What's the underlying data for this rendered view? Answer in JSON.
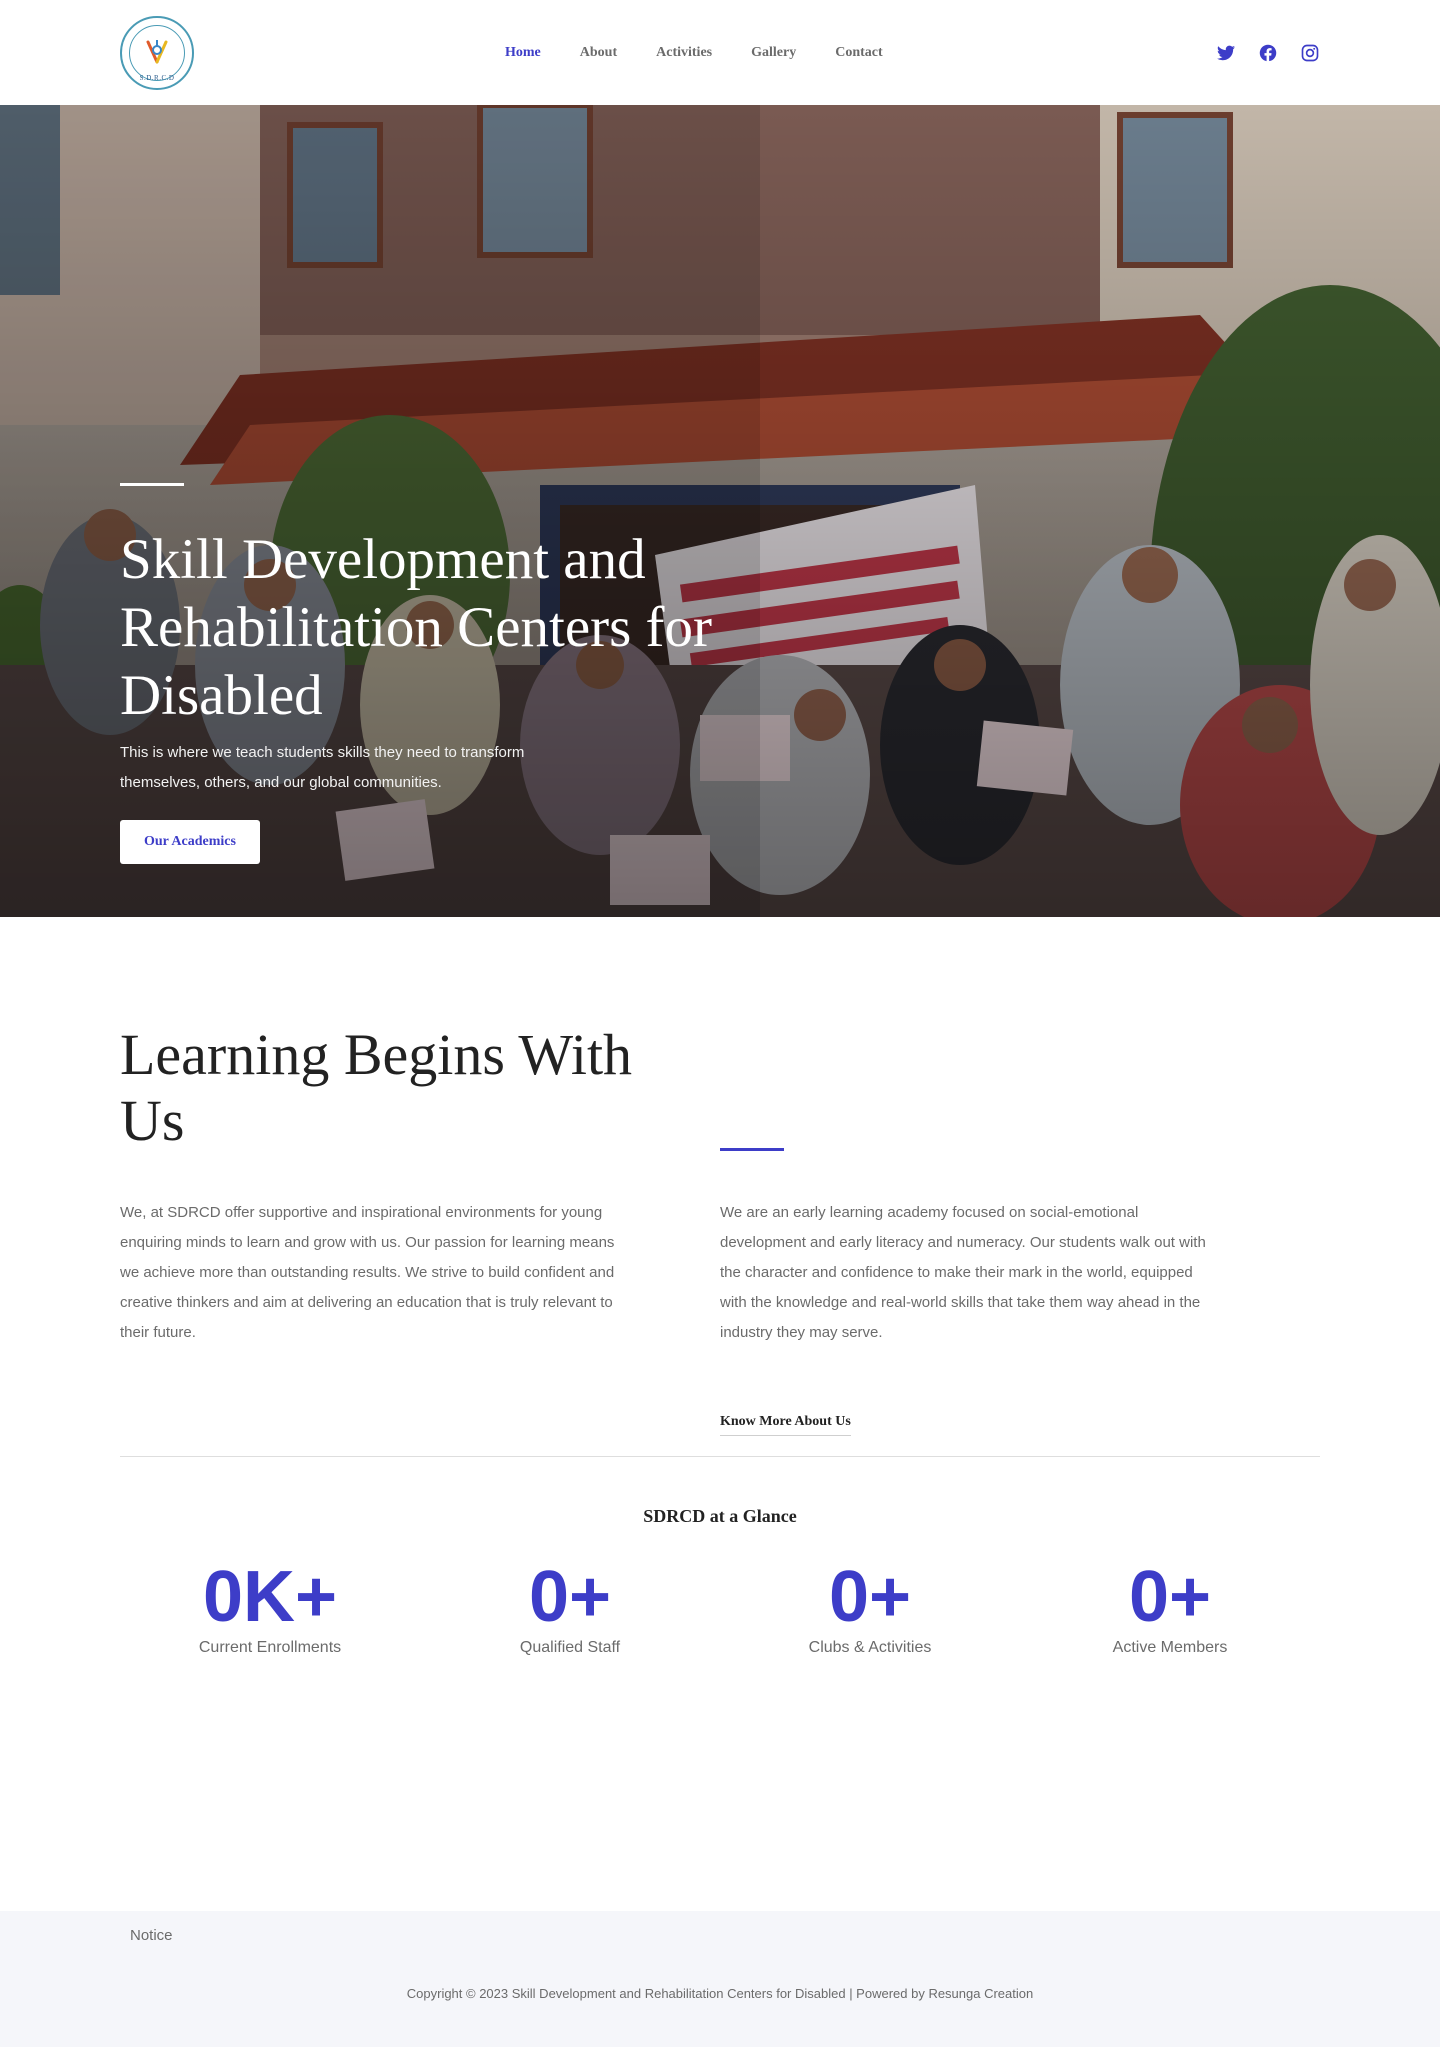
{
  "brand": {
    "logo_text": "S.D.R.C.D",
    "logo_alt": "SDRCD logo"
  },
  "nav": {
    "items": [
      {
        "label": "Home",
        "active": true
      },
      {
        "label": "About"
      },
      {
        "label": "Activities"
      },
      {
        "label": "Gallery"
      },
      {
        "label": "Contact"
      }
    ]
  },
  "social": {
    "icons": [
      "twitter-icon",
      "facebook-icon",
      "instagram-icon"
    ]
  },
  "colors": {
    "accent": "#3d3dc8",
    "footer_bg": "#f5f6fa"
  },
  "hero": {
    "title": "Skill Development and Rehabilitation Centers for Disabled",
    "subtitle": "This is where we teach students skills they need to transform themselves, others, and our global communities.",
    "button": "Our Academics"
  },
  "learning": {
    "title": "Learning Begins With Us",
    "left_text": "We, at SDRCD offer supportive and inspirational environments for young enquiring minds to learn and grow with us. Our passion for learning means we achieve more than outstanding results. We strive to build confident and creative thinkers and aim at delivering an education that is truly relevant to their future.",
    "right_text": "We are an early learning academy focused on social-emotional development and early literacy and numeracy. Our students walk out with the character and confidence to make their mark in the world, equipped with the knowledge and real-world skills that take them way ahead in the industry they may serve.",
    "link": "Know More About Us"
  },
  "glance": {
    "title": "SDRCD at a Glance",
    "stats": [
      {
        "value": "0K+",
        "label": "Current Enrollments"
      },
      {
        "value": "0+",
        "label": "Qualified Staff"
      },
      {
        "value": "0+",
        "label": "Clubs & Activities"
      },
      {
        "value": "0+",
        "label": "Active Members"
      }
    ]
  },
  "footer": {
    "notice": "Notice",
    "copyright": "Copyright © 2023 Skill Development and Rehabilitation Centers for Disabled | Powered by Resunga Creation"
  }
}
